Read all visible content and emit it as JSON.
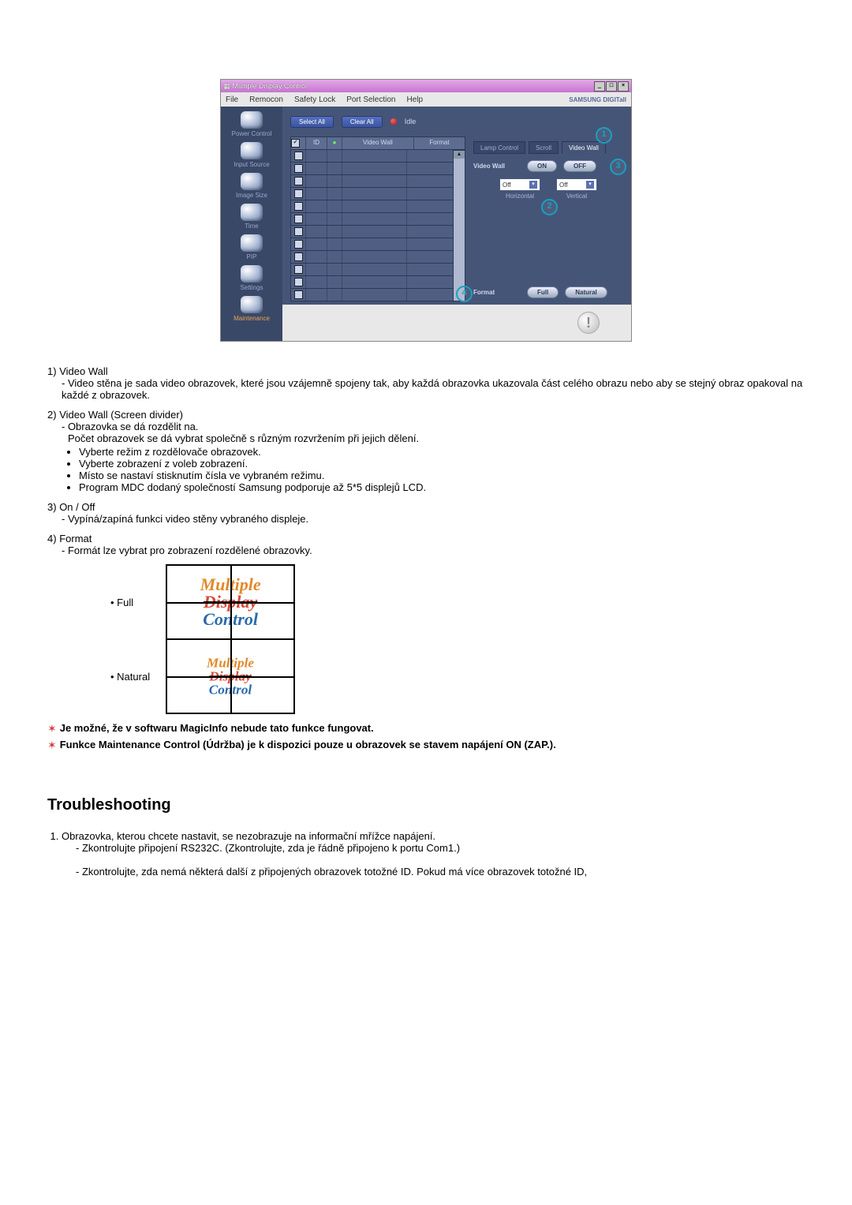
{
  "app": {
    "title": "Multiple Display Control",
    "window_buttons": [
      "_",
      "□",
      "×"
    ],
    "menus": [
      "File",
      "Remocon",
      "Safety Lock",
      "Port Selection",
      "Help"
    ],
    "brand": "SAMSUNG DIGITall"
  },
  "sidebar": {
    "items": [
      {
        "label": "Power Control"
      },
      {
        "label": "Input Source"
      },
      {
        "label": "Image Size"
      },
      {
        "label": "Time"
      },
      {
        "label": "PIP"
      },
      {
        "label": "Settings"
      },
      {
        "label": "Maintenance"
      }
    ]
  },
  "toolbar": {
    "select_all": "Select All",
    "clear_all": "Clear All",
    "idle": "Idle"
  },
  "grid": {
    "headers": {
      "check": "",
      "id": "ID",
      "state": "",
      "video_wall": "Video Wall",
      "format": "Format"
    },
    "row_count": 12,
    "first_checked": true
  },
  "right": {
    "tabs": [
      "Lamp Control",
      "Scroll",
      "Video Wall"
    ],
    "active_tab": 2,
    "video_wall_label": "Video Wall",
    "on": "ON",
    "off": "OFF",
    "horiz": {
      "label": "Horizontal",
      "value": "Off"
    },
    "vert": {
      "label": "Vertical",
      "value": "Off"
    },
    "format_label": "Format",
    "full": "Full",
    "natural": "Natural"
  },
  "callouts": {
    "c1": "1",
    "c2": "2",
    "c3": "3",
    "c4": "4"
  },
  "doc": {
    "items": [
      {
        "num": "1)",
        "title": "Video Wall",
        "sub": "- Video stěna je sada video obrazovek, které jsou vzájemně spojeny tak, aby každá obrazovka ukazovala část celého obrazu nebo aby se stejný obraz opakoval na každé z obrazovek."
      },
      {
        "num": "2)",
        "title": "Video Wall (Screen divider)",
        "sub": "- Obrazovka se dá rozdělit na.",
        "sub2": "Počet obrazovek se dá vybrat společně s různým rozvržením při jejich dělení.",
        "bullets": [
          "Vyberte režim z rozdělovače obrazovek.",
          "Vyberte zobrazení z voleb zobrazení.",
          "Místo se nastaví stisknutím čísla ve vybraném režimu.",
          "Program MDC dodaný společností Samsung podporuje až 5*5 displejů LCD."
        ]
      },
      {
        "num": "3)",
        "title": "On / Off",
        "sub": "- Vypíná/zapíná funkci video stěny vybraného displeje."
      },
      {
        "num": "4)",
        "title": "Format",
        "sub": "- Formát lze vybrat pro zobrazení rozdělené obrazovky."
      }
    ],
    "fmt_full": "Full",
    "fmt_natural": "Natural",
    "mdc_lines": [
      "Multiple",
      "Display",
      "Control"
    ],
    "notes": [
      "Je možné, že v softwaru MagicInfo nebude tato funkce fungovat.",
      "Funkce Maintenance Control (Údržba) je k dispozici pouze u obrazovek se stavem napájení ON (ZAP.)."
    ]
  },
  "troubleshooting": {
    "heading": "Troubleshooting",
    "item1": "Obrazovka, kterou chcete nastavit, se nezobrazuje na informační mřížce napájení.",
    "sub1": "- Zkontrolujte připojení RS232C. (Zkontrolujte, zda je řádně připojeno k portu Com1.)",
    "sub2": "- Zkontrolujte, zda nemá některá další z připojených obrazovek totožné ID. Pokud má více obrazovek totožné ID,"
  }
}
